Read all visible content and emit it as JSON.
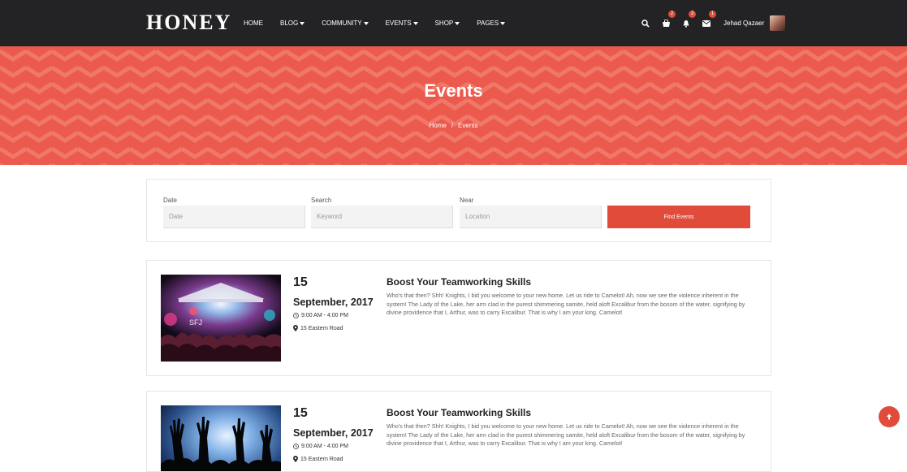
{
  "brand": {
    "logo": "HONEY",
    "accent_color": "#e04b3a",
    "hero_color": "#ec5a4d"
  },
  "nav": {
    "items": [
      {
        "label": "HOME",
        "dropdown": false
      },
      {
        "label": "BLOG",
        "dropdown": true
      },
      {
        "label": "COMMUNITY",
        "dropdown": true
      },
      {
        "label": "EVENTS",
        "dropdown": true
      },
      {
        "label": "SHOP",
        "dropdown": true
      },
      {
        "label": "PAGES",
        "dropdown": true
      }
    ],
    "icons": {
      "search": "search-icon",
      "cart": "cart-icon",
      "bell": "bell-icon",
      "mail": "mail-icon"
    },
    "badges": {
      "cart": "2",
      "notifications": "3",
      "messages": "1"
    },
    "user": {
      "name": "Jehad Qazaer"
    }
  },
  "hero": {
    "title": "Events",
    "breadcrumb": {
      "home": "Home",
      "separator": "/",
      "current": "Events"
    }
  },
  "search": {
    "date_label": "Date",
    "date_placeholder": "Date",
    "search_label": "Search",
    "search_placeholder": "Keyword",
    "near_label": "Near",
    "near_placeholder": "Location",
    "button_label": "Find Events"
  },
  "events": [
    {
      "day": "15",
      "month_year": "September, 2017",
      "time": "9:00 AM - 4:00 PM",
      "location": "15 Eastern Road",
      "title": "Boost Your Teamworking Skills",
      "description": "Who's that then? Shh! Knights, I bid you welcome to your new home. Let us ride to Camelot! Ah, now we see the violence inherent in the system! The Lady of the Lake, her arm clad in the purest shimmering samite, held aloft Excalibur from the bosom of the water, signifying by divine providence that I, Arthur, was to carry Excalibur. That is why I am your king. Camelot!",
      "image": "concert-stage-photo"
    },
    {
      "day": "15",
      "month_year": "September, 2017",
      "time": "9:00 AM - 4:00 PM",
      "location": "15 Eastern Road",
      "title": "Boost Your Teamworking Skills",
      "description": "Who's that then? Shh! Knights, I bid you welcome to your new home. Let us ride to Camelot! Ah, now we see the violence inherent in the system! The Lady of the Lake, her arm clad in the purest shimmering samite, held aloft Excalibur from the bosom of the water, signifying by divine providence that I, Arthur, was to carry Excalibur. That is why I am your king. Camelot!",
      "image": "crowd-hands-photo"
    }
  ]
}
